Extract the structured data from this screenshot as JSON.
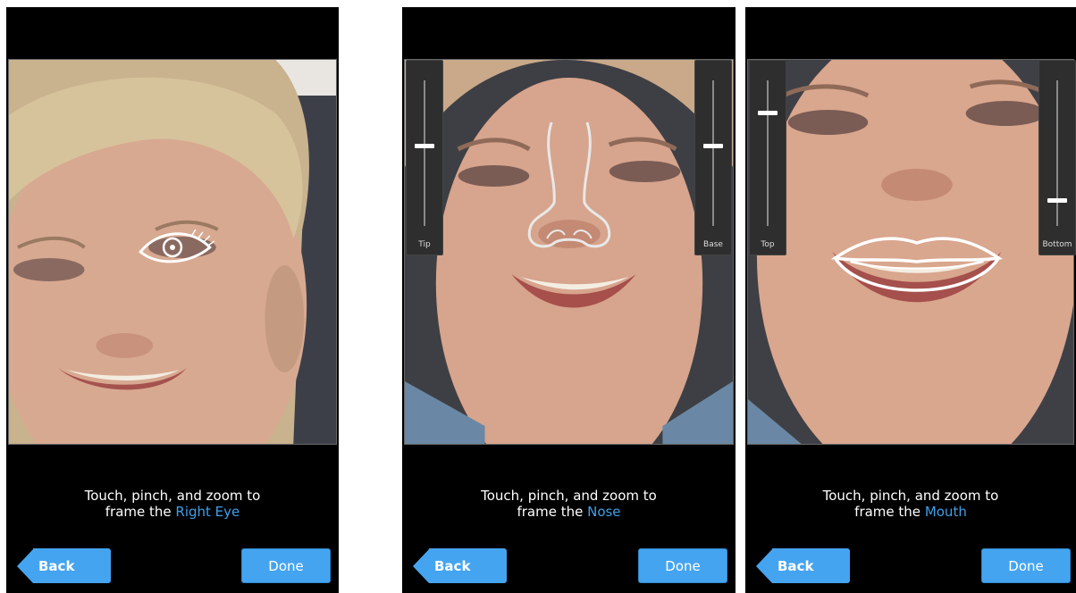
{
  "screens": [
    {
      "instruction_line1": "Touch, pinch, and zoom to",
      "instruction_prefix": "frame the ",
      "feature": "Right Eye",
      "back_label": "Back",
      "done_label": "Done",
      "overlay_icon": "eye-outline-icon"
    },
    {
      "instruction_line1": "Touch, pinch, and zoom to",
      "instruction_prefix": "frame the ",
      "feature": "Nose",
      "back_label": "Back",
      "done_label": "Done",
      "overlay_icon": "nose-outline-icon",
      "sliders": [
        {
          "label": "Tip",
          "value": 0.55
        },
        {
          "label": "Base",
          "value": 0.55
        }
      ]
    },
    {
      "instruction_line1": "Touch, pinch, and zoom to",
      "instruction_prefix": "frame the ",
      "feature": "Mouth",
      "back_label": "Back",
      "done_label": "Done",
      "overlay_icon": "lips-outline-icon",
      "sliders": [
        {
          "label": "Top",
          "value": 0.78
        },
        {
          "label": "Bottom",
          "value": 0.18
        }
      ]
    }
  ],
  "colors": {
    "accent": "#3ea0ea",
    "button": "#45a4f0",
    "background": "#000000"
  }
}
